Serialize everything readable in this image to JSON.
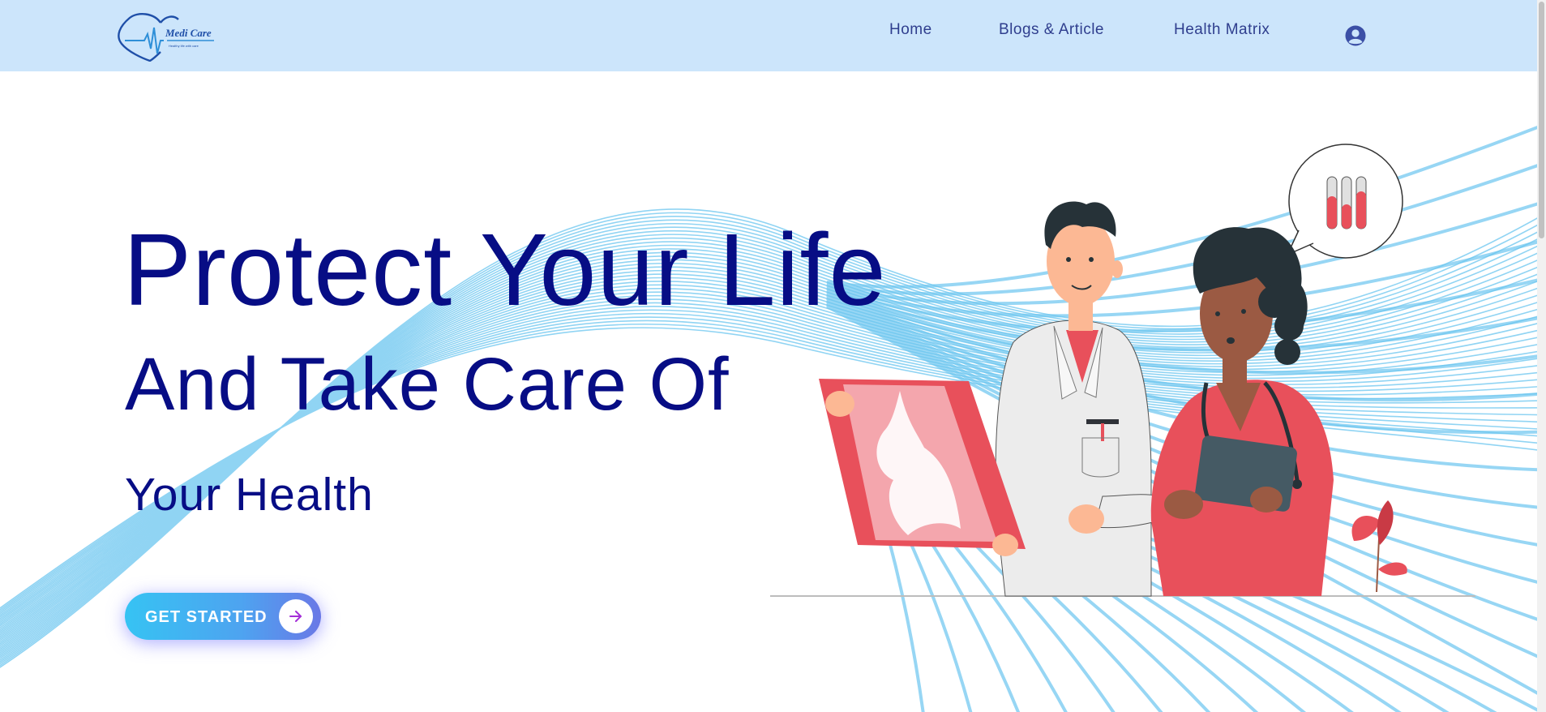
{
  "brand": {
    "name": "Medi Care",
    "tagline": "Healthy life with care",
    "color": "#1f4fa8"
  },
  "nav": {
    "items": [
      {
        "label": "Home"
      },
      {
        "label": "Blogs & Article"
      },
      {
        "label": "Health Matrix"
      }
    ],
    "profile_icon": "user-circle-icon"
  },
  "hero": {
    "line1": "Protect Your Life",
    "line2": "And Take Care Of",
    "line3": "Your Health",
    "cta_label": "GET STARTED",
    "cta_icon": "arrow-right-icon"
  },
  "colors": {
    "navbar_bg": "#cce5fb",
    "heading": "#070d85",
    "nav_text": "#2f3e8e",
    "accent_red": "#e8505b",
    "wave": "#6cc6f0"
  }
}
